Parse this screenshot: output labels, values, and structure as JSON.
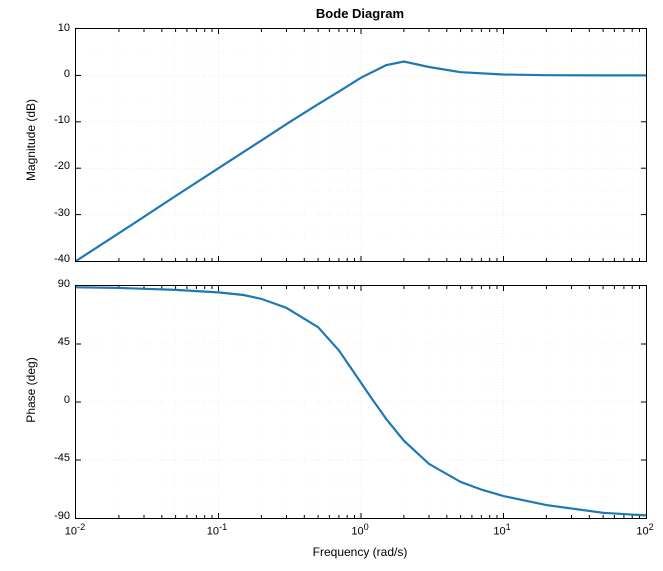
{
  "chart_data": [
    {
      "type": "line",
      "title": "Bode Diagram",
      "xlabel": "",
      "ylabel": "Magnitude (dB)",
      "xscale": "log",
      "xlim": [
        0.01,
        100
      ],
      "ylim": [
        -40,
        10
      ],
      "yticks": [
        -40,
        -30,
        -20,
        -10,
        0,
        10
      ],
      "xticks": [
        0.01,
        0.1,
        1,
        10,
        100
      ],
      "series": [
        {
          "name": "magnitude",
          "x": [
            0.01,
            0.02,
            0.05,
            0.1,
            0.2,
            0.3,
            0.5,
            0.7,
            1,
            1.5,
            2,
            3,
            5,
            10,
            20,
            50,
            100
          ],
          "y": [
            -40,
            -34,
            -26,
            -20,
            -14,
            -10.5,
            -6.2,
            -3.5,
            -0.5,
            2.2,
            3,
            1.8,
            0.7,
            0.2,
            0.05,
            0.01,
            0
          ]
        }
      ]
    },
    {
      "type": "line",
      "title": "",
      "xlabel": "Frequency (rad/s)",
      "ylabel": "Phase (deg)",
      "xscale": "log",
      "xlim": [
        0.01,
        100
      ],
      "ylim": [
        -90,
        90
      ],
      "yticks": [
        -90,
        -45,
        0,
        45,
        90
      ],
      "xticks": [
        0.01,
        0.1,
        1,
        10,
        100
      ],
      "xticklabels": [
        "10^{-2}",
        "10^{-1}",
        "10^{0}",
        "10^{1}",
        "10^{2}"
      ],
      "series": [
        {
          "name": "phase",
          "x": [
            0.01,
            0.02,
            0.05,
            0.1,
            0.15,
            0.2,
            0.3,
            0.5,
            0.7,
            1,
            1.2,
            1.5,
            2,
            3,
            5,
            7,
            10,
            20,
            50,
            100
          ],
          "y": [
            89,
            88.5,
            87,
            85,
            83,
            80,
            73,
            58,
            40,
            15,
            2,
            -13,
            -30,
            -48,
            -62,
            -68,
            -73,
            -80,
            -86,
            -88
          ]
        }
      ]
    }
  ],
  "title": "Bode Diagram",
  "ylabel1": "Magnitude (dB)",
  "ylabel2": "Phase (deg)",
  "xlabel2": "Frequency (rad/s)",
  "mag_ticks": {
    "m40": "-40",
    "m30": "-30",
    "m20": "-20",
    "m10": "-10",
    "p0": "0",
    "p10": "10"
  },
  "phase_ticks": {
    "m90": "-90",
    "m45": "-45",
    "p0": "0",
    "p45": "45",
    "p90": "90"
  },
  "freq_ticks": {
    "t0": {
      "base": "10",
      "exp": "-2"
    },
    "t1": {
      "base": "10",
      "exp": "-1"
    },
    "t2": {
      "base": "10",
      "exp": "0"
    },
    "t3": {
      "base": "10",
      "exp": "1"
    },
    "t4": {
      "base": "10",
      "exp": "2"
    }
  }
}
